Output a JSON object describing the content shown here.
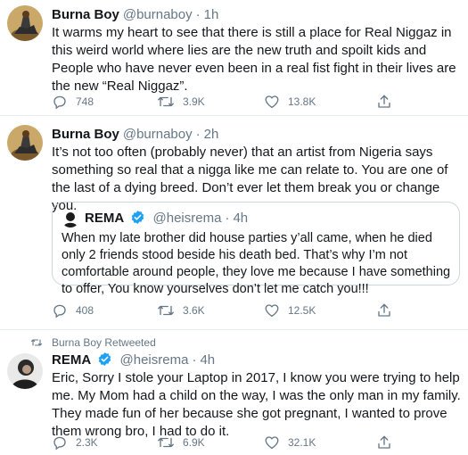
{
  "tweets": [
    {
      "name": "Burna Boy",
      "handle": "@burnaboy",
      "time": "1h",
      "text": "It warms my heart to see that there is still a place for Real Niggaz in this weird world where lies are the new truth and spoilt kids and People who have never even been in a real fist fight in their lives are the new “Real Niggaz”.",
      "replies": "748",
      "retweets": "3.9K",
      "likes": "13.8K"
    },
    {
      "name": "Burna Boy",
      "handle": "@burnaboy",
      "time": "2h",
      "text": "It’s not too often (probably never) that an artist from Nigeria says something so real that a nigga like me can relate to. You are one of the last of a dying breed. Don’t ever let them break you or change you.",
      "quote": {
        "name": "REMA",
        "handle": "@heisrema",
        "time": "4h",
        "text": "When my late brother did house parties y’all came, when he died only 2 friends stood beside his death bed. That’s why I’m not comfortable around people, they love me because I have something to offer, You know yourselves don’t let me catch you!!!"
      },
      "replies": "408",
      "retweets": "3.6K",
      "likes": "12.5K"
    },
    {
      "retweeted_by": "Burna Boy Retweeted",
      "name": "REMA",
      "handle": "@heisrema",
      "time": "4h",
      "text": "Eric, Sorry I stole your Laptop in 2017, I know you were trying to help me. My Mom had a child on the way,  I was the only man in my family. They made fun of her because she got pregnant, I wanted to prove them wrong bro, I had to do it.",
      "replies": "2.3K",
      "retweets": "6.9K",
      "likes": "32.1K"
    }
  ],
  "colors": {
    "verified": "#1da1f2",
    "secondary_text": "#657786",
    "divider": "#e6ecf0"
  }
}
